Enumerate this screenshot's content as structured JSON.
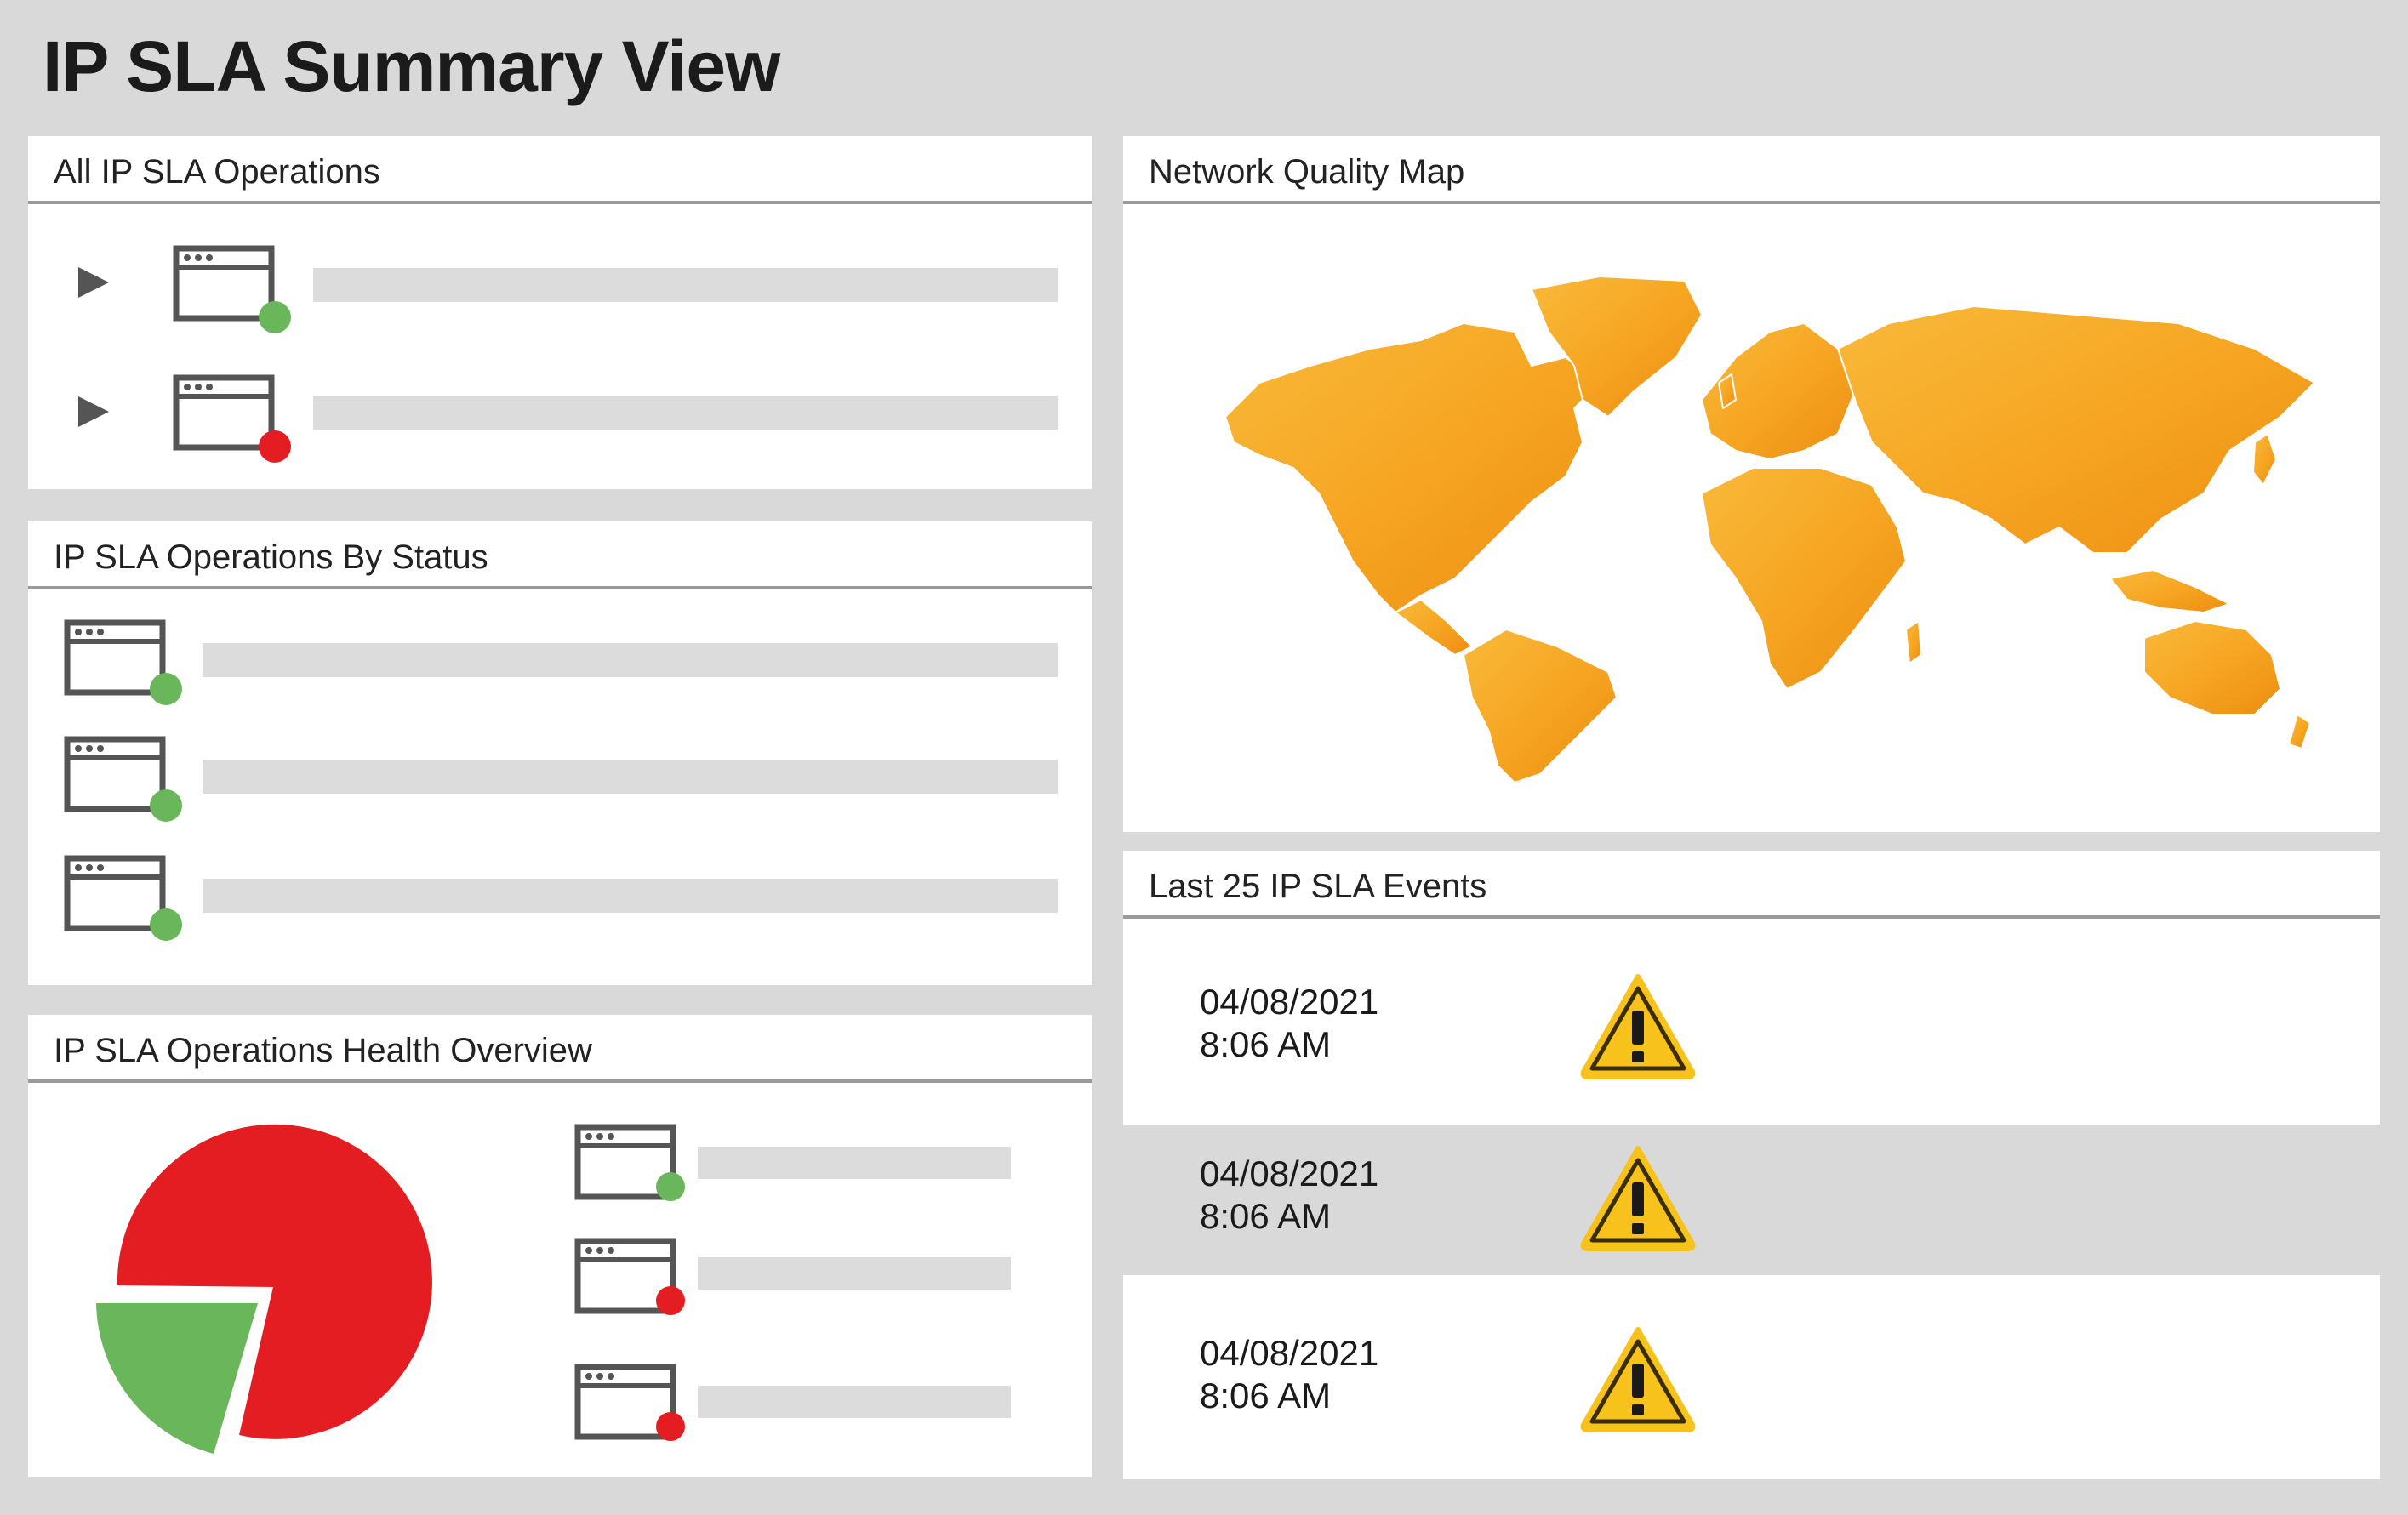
{
  "page": {
    "title": "IP SLA Summary View"
  },
  "all_ops": {
    "title": "All IP SLA Operations",
    "items": [
      {
        "status": "up",
        "status_color": "#6ab65a"
      },
      {
        "status": "down",
        "status_color": "#e41d22"
      }
    ]
  },
  "by_status": {
    "title": "IP SLA Operations By Status",
    "items": [
      {
        "status": "up",
        "status_color": "#6ab65a"
      },
      {
        "status": "up",
        "status_color": "#6ab65a"
      },
      {
        "status": "up",
        "status_color": "#6ab65a"
      }
    ]
  },
  "health": {
    "title": "IP SLA Operations Health Overview",
    "pie": {
      "down_color": "#e41d22",
      "up_color": "#6ab65a"
    },
    "items": [
      {
        "status": "up",
        "status_color": "#6ab65a"
      },
      {
        "status": "down",
        "status_color": "#e41d22"
      },
      {
        "status": "down",
        "status_color": "#e41d22"
      }
    ]
  },
  "map": {
    "title": "Network Quality Map",
    "land_color": "#f6a623"
  },
  "events": {
    "title": "Last 25 IP SLA Events",
    "rows": [
      {
        "date": "04/08/2021",
        "time": "8:06 AM",
        "icon": "warning-icon"
      },
      {
        "date": "04/08/2021",
        "time": "8:06 AM",
        "icon": "warning-icon"
      },
      {
        "date": "04/08/2021",
        "time": "8:06 AM",
        "icon": "warning-icon"
      }
    ]
  },
  "colors": {
    "background": "#d9d9d9",
    "panel": "#ffffff",
    "placeholder_bar": "#dcdcdc",
    "icon_stroke": "#555555",
    "warning_fill": "#f7c21b"
  }
}
